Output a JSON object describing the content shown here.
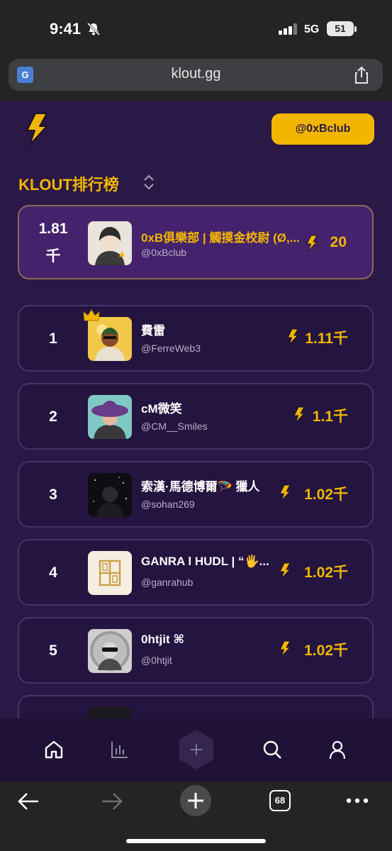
{
  "status_bar": {
    "time": "9:41",
    "network": "5G",
    "battery": "51"
  },
  "browser": {
    "url": "klout.gg",
    "translate_badge": "G",
    "tabs_count": "68"
  },
  "header": {
    "account_button": "@0xBclub"
  },
  "leaderboard": {
    "title": "KLOUT排行榜",
    "current_user": {
      "klout_line1": "1.81",
      "klout_line2": "千",
      "name": "0xB俱樂部 | 觸摸金校尉 (Ø,...",
      "handle": "@0xBclub",
      "score": "20"
    },
    "entries": [
      {
        "rank": "1",
        "name": "費雷",
        "handle": "@FerreWeb3",
        "score": "1.11千"
      },
      {
        "rank": "2",
        "name": "cM微笑",
        "handle": "@CM__Smiles",
        "score": "1.1千"
      },
      {
        "rank": "3",
        "name": "索漢·馬德博爾🪂 獵人",
        "handle": "@sohan269",
        "score": "1.02千"
      },
      {
        "rank": "4",
        "name": "GANRA l HUDL | “🖐...",
        "handle": "@ganrahub",
        "score": "1.02千"
      },
      {
        "rank": "5",
        "name": "0htjit ⌘",
        "handle": "@0htjit",
        "score": "1.02千"
      }
    ]
  },
  "colors": {
    "accent": "#f2b600",
    "background": "#2a1846",
    "card": "#241440",
    "highlight_card": "#44226c"
  },
  "icons": {
    "nav": [
      "home-icon",
      "stats-icon",
      "plus-icon",
      "search-icon",
      "profile-icon"
    ],
    "browser": [
      "back-icon",
      "forward-icon",
      "new-tab-icon",
      "tabs-icon",
      "more-icon"
    ]
  }
}
